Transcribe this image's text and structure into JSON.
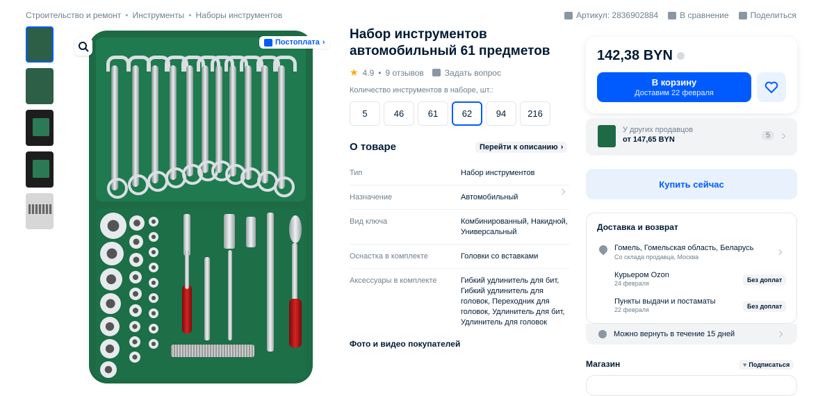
{
  "breadcrumb": [
    "Строительство и ремонт",
    "Инструменты",
    "Наборы инструментов"
  ],
  "breadcrumb_sep": "•",
  "topbar": {
    "article": "Артикул: 2836902884",
    "compare": "В сравнение",
    "share": "Поделиться"
  },
  "gallery": {
    "thumb_icons": [
      "tool-case-thumb",
      "tool-case-thumb",
      "tool-case-dark-thumb",
      "tool-case-dark-thumb",
      "socket-row-thumb"
    ],
    "badge": "Постоплата"
  },
  "product": {
    "title": "Набор инструментов автомобильный 61 предметов",
    "rating": "4.9",
    "reviews": "9 отзывов",
    "ask": "Задать вопрос",
    "qty_label": "Количество инструментов в наборе, шт.:",
    "qty_options": [
      "5",
      "46",
      "61",
      "62",
      "94",
      "216"
    ],
    "qty_selected": "62"
  },
  "about": {
    "title": "О товаре",
    "to_description": "Перейти к описанию",
    "specs": [
      {
        "k": "Тип",
        "v": "Набор инструментов"
      },
      {
        "k": "Назначение",
        "v": "Автомобильный"
      },
      {
        "k": "Вид ключа",
        "v": "Комбинированный, Накидной, Универсальный"
      },
      {
        "k": "Оснастка в комплекте",
        "v": "Головки со вставками"
      },
      {
        "k": "Аксессуары в комплекте",
        "v": "Гибкий удлинитель для бит, Гибкий удлинитель для головок, Переходник для головок, Удлинитель для бит, Удлинитель для головок"
      }
    ],
    "ugc_title": "Фото и видео покупателей"
  },
  "buy": {
    "price": "142,38 BYN",
    "cart_label": "В корзину",
    "cart_sub": "Доставим 22 февраля",
    "sellers_label": "У других продавцов",
    "sellers_price": "от 147,65 BYN",
    "sellers_count": "5",
    "buy_now": "Купить сейчас"
  },
  "delivery": {
    "title": "Доставка и возврат",
    "location": "Гомель, Гомельская область, Беларусь",
    "location_sub": "Со склада продавца, Москва",
    "methods": [
      {
        "name": "Курьером Ozon",
        "date": "24 февраля",
        "badge": "Без доплат"
      },
      {
        "name": "Пункты выдачи и постаматы",
        "date": "22 февраля",
        "badge": "Без доплат"
      }
    ],
    "return": "Можно вернуть в течение 15 дней"
  },
  "shop": {
    "title": "Магазин",
    "subscribe": "Подписаться"
  },
  "colors": {
    "accent": "#005bff",
    "case_green": "#1d6a45",
    "text": "#001a34",
    "muted": "#707f8d"
  }
}
